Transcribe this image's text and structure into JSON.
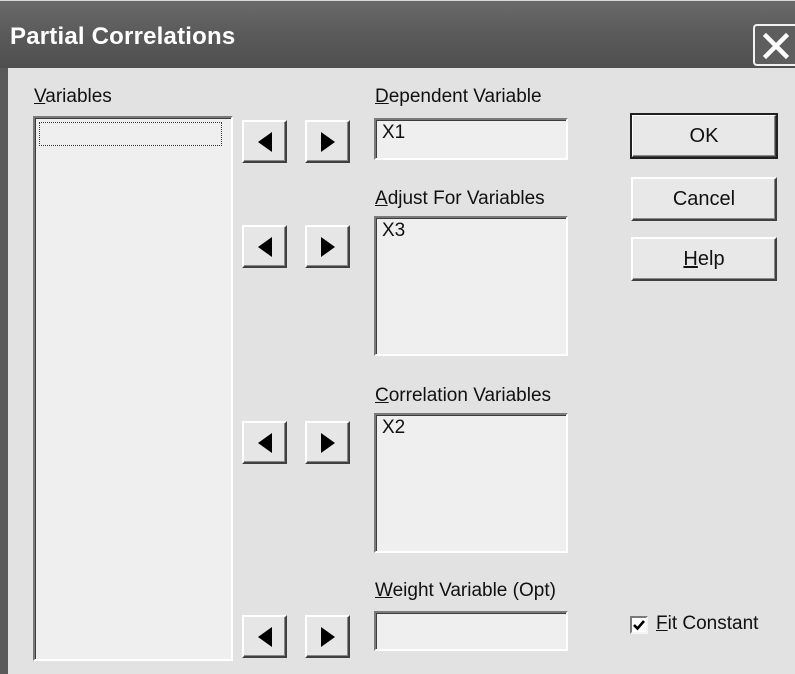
{
  "window": {
    "title": "Partial Correlations"
  },
  "variables": {
    "label_access": "V",
    "label_rest": "ariables",
    "items": [
      ""
    ]
  },
  "dependent": {
    "label_access": "D",
    "label_rest": "ependent Variable",
    "value": "X1"
  },
  "adjust": {
    "label_access": "A",
    "label_rest": "djust For Variables",
    "items": [
      "X3"
    ]
  },
  "correlation": {
    "label_access": "C",
    "label_rest": "orrelation Variables",
    "items": [
      "X2"
    ]
  },
  "weight": {
    "label_access": "W",
    "label_rest": "eight Variable (Opt)",
    "value": ""
  },
  "buttons": {
    "ok": "OK",
    "cancel": "Cancel",
    "help_access": "H",
    "help_rest": "elp"
  },
  "fit_constant": {
    "checked": true,
    "label_access": "F",
    "label_rest": "it Constant"
  },
  "icons": {
    "close": "close-icon",
    "move_left": "left-arrow-icon",
    "move_right": "right-arrow-icon",
    "checkmark": "checkmark-icon"
  }
}
